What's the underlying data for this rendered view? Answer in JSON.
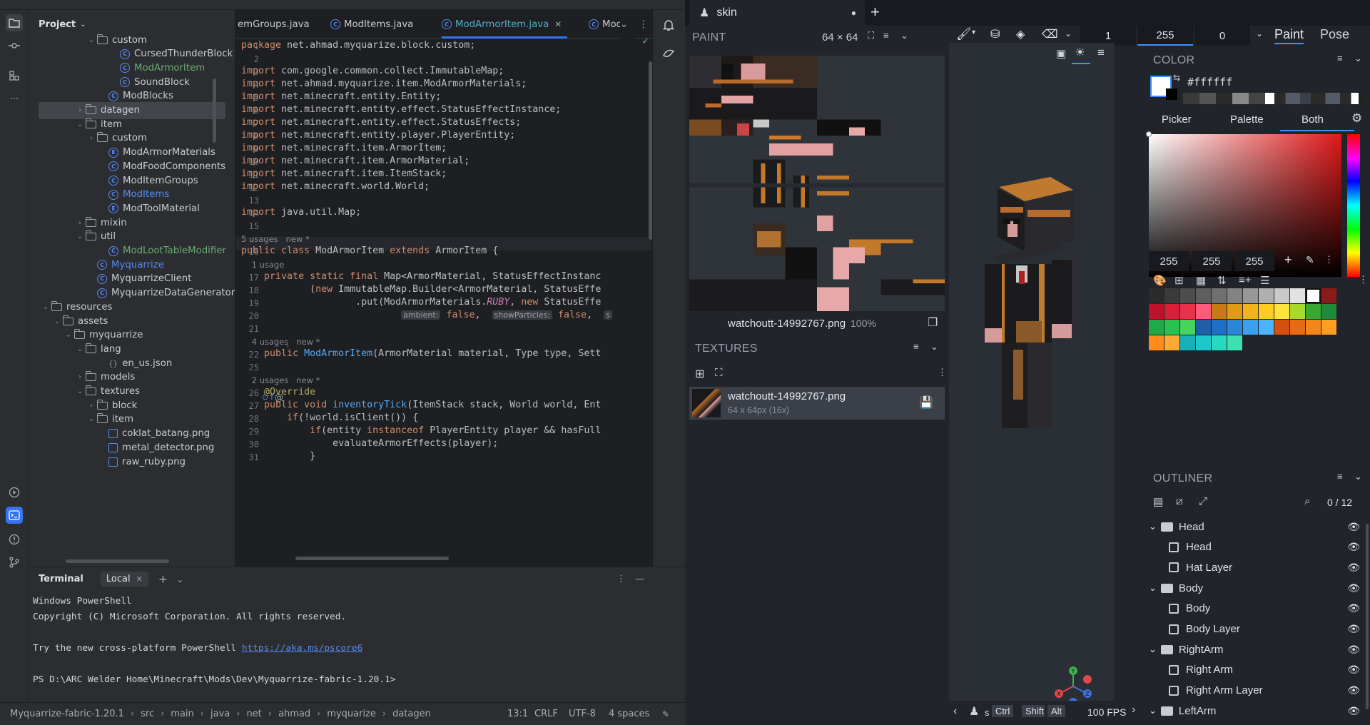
{
  "ide": {
    "project_label": "Project",
    "tree": [
      {
        "label": "custom",
        "type": "folder",
        "indent": 5,
        "open": true
      },
      {
        "label": "CursedThunderBlock",
        "type": "class",
        "indent": 7
      },
      {
        "label": "ModArmorItem",
        "type": "class",
        "indent": 7,
        "color": "green"
      },
      {
        "label": "SoundBlock",
        "type": "class",
        "indent": 7
      },
      {
        "label": "ModBlocks",
        "type": "class",
        "indent": 6
      },
      {
        "label": "datagen",
        "type": "folder",
        "indent": 4,
        "open": false,
        "selected": true
      },
      {
        "label": "item",
        "type": "folder",
        "indent": 4,
        "open": true
      },
      {
        "label": "custom",
        "type": "folder",
        "indent": 5,
        "open": false
      },
      {
        "label": "ModArmorMaterials",
        "type": "enum",
        "indent": 6
      },
      {
        "label": "ModFoodComponents",
        "type": "class",
        "indent": 6
      },
      {
        "label": "ModItemGroups",
        "type": "class",
        "indent": 6
      },
      {
        "label": "ModItems",
        "type": "class",
        "indent": 6,
        "color": "blue"
      },
      {
        "label": "ModToolMaterial",
        "type": "enum",
        "indent": 6
      },
      {
        "label": "mixin",
        "type": "folder",
        "indent": 4,
        "open": false
      },
      {
        "label": "util",
        "type": "folder",
        "indent": 4,
        "open": true
      },
      {
        "label": "ModLootTableModifier",
        "type": "class",
        "indent": 6,
        "color": "green"
      },
      {
        "label": "Myquarrize",
        "type": "class",
        "indent": 5,
        "color": "blue"
      },
      {
        "label": "MyquarrizeClient",
        "type": "class",
        "indent": 5
      },
      {
        "label": "MyquarrizeDataGenerator",
        "type": "class",
        "indent": 5
      },
      {
        "label": "resources",
        "type": "folder",
        "indent": 1,
        "open": true
      },
      {
        "label": "assets",
        "type": "folder",
        "indent": 2,
        "open": true
      },
      {
        "label": "myquarrize",
        "type": "folder",
        "indent": 3,
        "open": true
      },
      {
        "label": "lang",
        "type": "folder",
        "indent": 4,
        "open": true
      },
      {
        "label": "en_us.json",
        "type": "json",
        "indent": 6
      },
      {
        "label": "models",
        "type": "folder",
        "indent": 4,
        "open": false
      },
      {
        "label": "textures",
        "type": "folder",
        "indent": 4,
        "open": true
      },
      {
        "label": "block",
        "type": "folder",
        "indent": 5,
        "open": false
      },
      {
        "label": "item",
        "type": "folder",
        "indent": 5,
        "open": true
      },
      {
        "label": "coklat_batang.png",
        "type": "image",
        "indent": 6
      },
      {
        "label": "metal_detector.png",
        "type": "image",
        "indent": 6
      },
      {
        "label": "raw_ruby.png",
        "type": "image",
        "indent": 6
      }
    ],
    "tabs": [
      {
        "label": "emGroups.java",
        "active": false
      },
      {
        "label": "ModItems.java",
        "active": false
      },
      {
        "label": "ModArmorItem.java",
        "active": true
      },
      {
        "label": "Mod",
        "active": false
      }
    ],
    "code": [
      {
        "n": "1",
        "html": "<span class='kw'>package</span> net.ahmad.myquarize.block.custom;"
      },
      {
        "n": "2",
        "html": ""
      },
      {
        "n": "3",
        "html": "<span class='kw'>import</span> com.google.common.collect.ImmutableMap;"
      },
      {
        "n": "4",
        "html": "<span class='kw'>import</span> net.ahmad.myquarize.item.ModArmorMaterials;"
      },
      {
        "n": "5",
        "html": "<span class='kw'>import</span> net.minecraft.entity.Entity;"
      },
      {
        "n": "6",
        "html": "<span class='kw'>import</span> net.minecraft.entity.effect.StatusEffectInstance;"
      },
      {
        "n": "7",
        "html": "<span class='kw'>import</span> net.minecraft.entity.effect.StatusEffects;"
      },
      {
        "n": "8",
        "html": "<span class='kw'>import</span> net.minecraft.entity.player.PlayerEntity;"
      },
      {
        "n": "9",
        "html": "<span class='kw'>import</span> net.minecraft.item.ArmorItem;"
      },
      {
        "n": "10",
        "html": "<span class='kw'>import</span> net.minecraft.item.ArmorMaterial;"
      },
      {
        "n": "11",
        "html": "<span class='kw'>import</span> net.minecraft.item.ItemStack;"
      },
      {
        "n": "12",
        "html": "<span class='kw'>import</span> net.minecraft.world.World;"
      },
      {
        "n": "13",
        "html": ""
      },
      {
        "n": "14",
        "html": "<span class='kw'>import</span> java.util.Map;"
      },
      {
        "n": "15",
        "html": ""
      },
      {
        "hint": "5 usages   new *"
      },
      {
        "n": "16",
        "html": "<span class='kw'>public class</span> ModArmorItem <span class='kw'>extends</span> ArmorItem {"
      },
      {
        "hint": "    1 usage"
      },
      {
        "n": "17",
        "html": "    <span class='kw'>private static final</span> Map&lt;ArmorMaterial, StatusEffectInstanc"
      },
      {
        "n": "18",
        "html": "            (<span class='kw'>new</span> ImmutableMap.Builder&lt;ArmorMaterial, StatusEffe"
      },
      {
        "n": "19",
        "html": "                    .put(ModArmorMaterials.<span class='ct'>RUBY</span>, <span class='kw'>new</span> StatusEffe"
      },
      {
        "n": "20",
        "html": "                            <span class='pill'>ambient:</span> <span class='kw'>false</span>,  <span class='pill'>showParticles:</span> <span class='kw'>false</span>,  <span class='pill'>s</span>"
      },
      {
        "n": "21",
        "html": ""
      },
      {
        "hint": "    4 usages   new *"
      },
      {
        "n": "22",
        "html": "    <span class='kw'>public</span> <span class='fn'>ModArmorItem</span>(ArmorMaterial material, Type type, Sett"
      },
      {
        "n": "25",
        "html": ""
      },
      {
        "hint": "    2 usages   new *"
      },
      {
        "n": "26",
        "html": "    <span class='an'>@Override</span>"
      },
      {
        "n": "27",
        "html": "    <span class='kw'>public void</span> <span class='fn'>inventoryTick</span>(ItemStack stack, World world, Ent"
      },
      {
        "n": "28",
        "html": "        <span class='kw'>if</span>(!world.isClient()) {"
      },
      {
        "n": "29",
        "html": "            <span class='kw'>if</span>(entity <span class='kw'>instanceof</span> PlayerEntity player &amp;&amp; hasFull"
      },
      {
        "n": "30",
        "html": "                evaluateArmorEffects(player);"
      },
      {
        "n": "31",
        "html": "            }"
      }
    ],
    "terminal": {
      "title": "Terminal",
      "tab": "Local",
      "lines": [
        "Windows PowerShell",
        "Copyright (C) Microsoft Corporation. All rights reserved.",
        "",
        "Try the new cross-platform PowerShell ",
        "",
        "PS D:\\ARC Welder Home\\Minecraft\\Mods\\Dev\\Myquarrize-fabric-1.20.1>"
      ],
      "link": "https://aka.ms/pscore6"
    },
    "status": {
      "breadcrumb": [
        "Myquarrize-fabric-1.20.1",
        "src",
        "main",
        "java",
        "net",
        "ahmad",
        "myquarize",
        "datagen"
      ],
      "position": "13:1",
      "line_ending": "CRLF",
      "encoding": "UTF-8",
      "indent": "4 spaces"
    }
  },
  "bb": {
    "tab_name": "skin",
    "paint_title": "PAINT",
    "paint_size": "64 × 64",
    "brush_size": "1",
    "opacity": "255",
    "softness": "0",
    "mode_paint": "Paint",
    "mode_pose": "Pose",
    "texture_file": "watchoutt-14992767.png",
    "zoom": "100%",
    "textures_title": "TEXTURES",
    "texture_item_name": "watchoutt-14992767.png",
    "texture_item_meta": "64 x 64px (16x)",
    "color_title": "COLOR",
    "hex": "#ffffff",
    "color_tabs": [
      "Picker",
      "Palette",
      "Both"
    ],
    "rgb": [
      "255",
      "255",
      "255"
    ],
    "outliner_title": "OUTLINER",
    "outliner_count": "0 / 12",
    "outliner": [
      {
        "label": "Head",
        "type": "group"
      },
      {
        "label": "Head",
        "type": "cube"
      },
      {
        "label": "Hat Layer",
        "type": "cube"
      },
      {
        "label": "Body",
        "type": "group"
      },
      {
        "label": "Body",
        "type": "cube"
      },
      {
        "label": "Body Layer",
        "type": "cube"
      },
      {
        "label": "RightArm",
        "type": "group"
      },
      {
        "label": "Right Arm",
        "type": "cube"
      },
      {
        "label": "Right Arm Layer",
        "type": "cube"
      },
      {
        "label": "LeftArm",
        "type": "group"
      }
    ],
    "fps": "100 FPS",
    "keys": [
      "s",
      "Ctrl",
      "Shift",
      "Alt"
    ],
    "palette": [
      "#2b2b2b",
      "#3a3a3a",
      "#4d4d4d",
      "#5e5e5e",
      "#707070",
      "#828282",
      "#989898",
      "#b0b0b0",
      "#c9c9c9",
      "#e2e2e2",
      "#ffffff",
      "#8b1a1a",
      "#c0102a",
      "#d91e36",
      "#ec2f4b",
      "#ff5a7a",
      "#c97a12",
      "#e09a13",
      "#f2b418",
      "#ffcc1f",
      "#ffe23b",
      "#a8d92b",
      "#38a832",
      "#1f8a3a",
      "#1faa48",
      "#28c24f",
      "#45d45c",
      "#1f5fa8",
      "#1f6fc4",
      "#2a86d9",
      "#3aa0ef",
      "#4ab4ff",
      "#d4500f",
      "#e86a12",
      "#f58618",
      "#ff9e22",
      "#ff8c1a",
      "#ffa838",
      "#18b0b8",
      "#1cc8c8",
      "#28d8c0",
      "#3ee0b0"
    ]
  }
}
